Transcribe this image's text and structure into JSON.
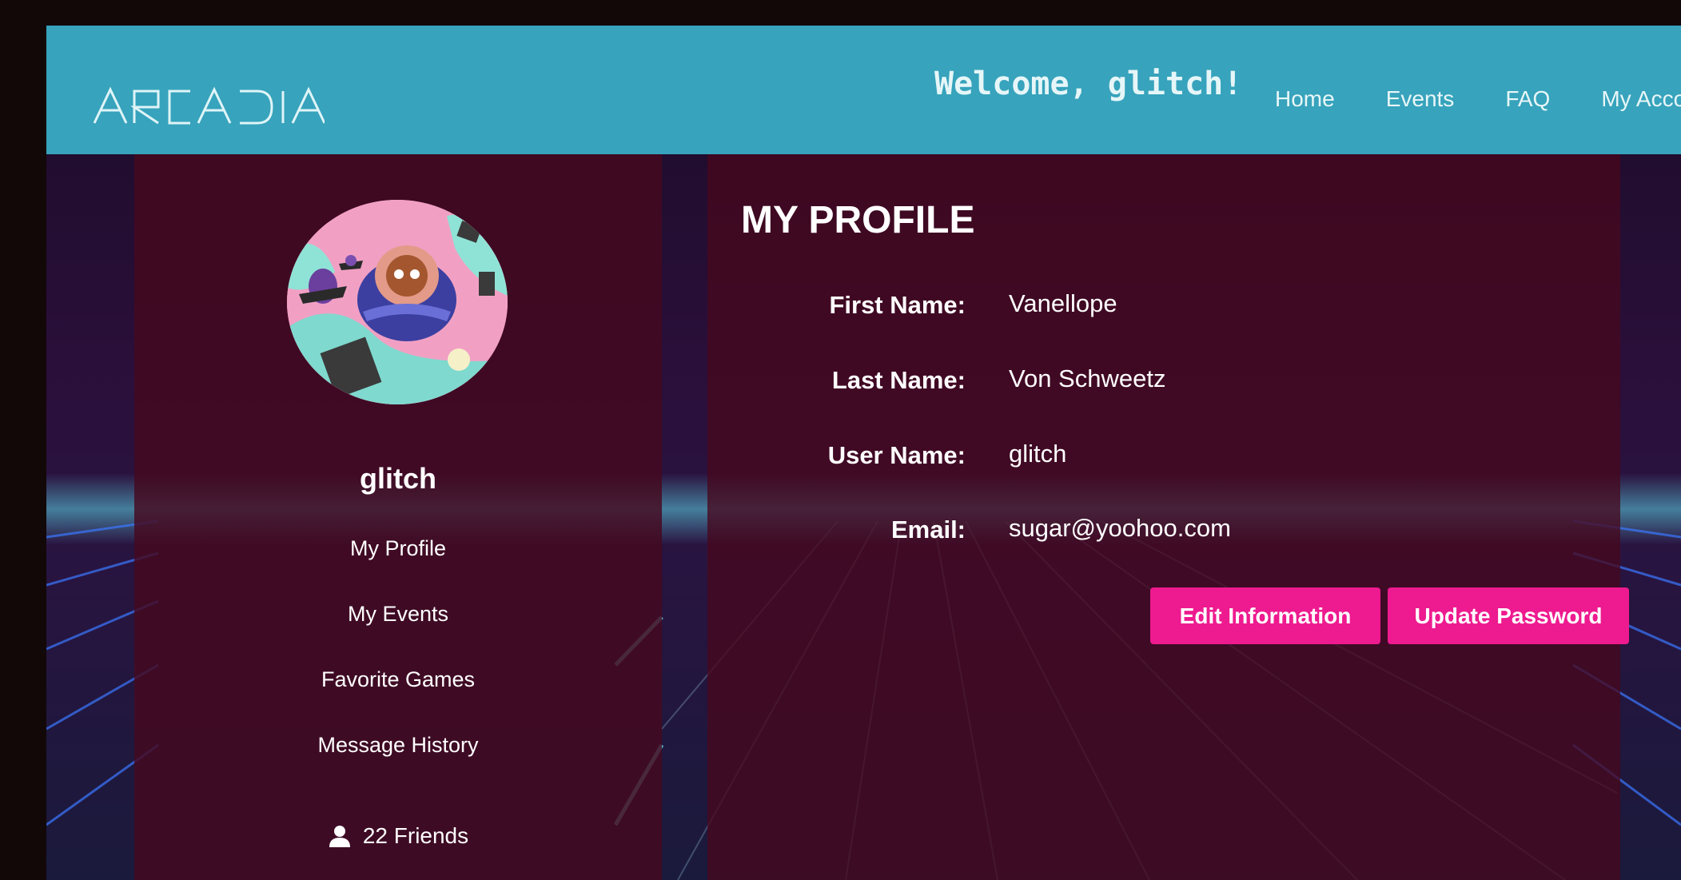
{
  "brand": {
    "logo_text": "ARCADIA",
    "welcome": "Welcome, glitch!"
  },
  "nav": {
    "items": [
      "Home",
      "Events",
      "FAQ",
      "My Acco"
    ]
  },
  "sidebar": {
    "username": "glitch",
    "menu": [
      "My Profile",
      "My Events",
      "Favorite Games",
      "Message History"
    ],
    "friends_label": "22 Friends",
    "friends_icon": "user-icon"
  },
  "profile": {
    "title": "MY PROFILE",
    "fields": [
      {
        "label": "First Name:",
        "value": "Vanellope"
      },
      {
        "label": "Last Name:",
        "value": "Von Schweetz"
      },
      {
        "label": "User Name:",
        "value": "glitch"
      },
      {
        "label": "Email:",
        "value": "sugar@yoohoo.com"
      }
    ],
    "edit_button": "Edit Information",
    "password_button": "Update Password"
  },
  "colors": {
    "header": "#37a3bc",
    "accent": "#ee1a8f",
    "panel": "#46081e"
  }
}
